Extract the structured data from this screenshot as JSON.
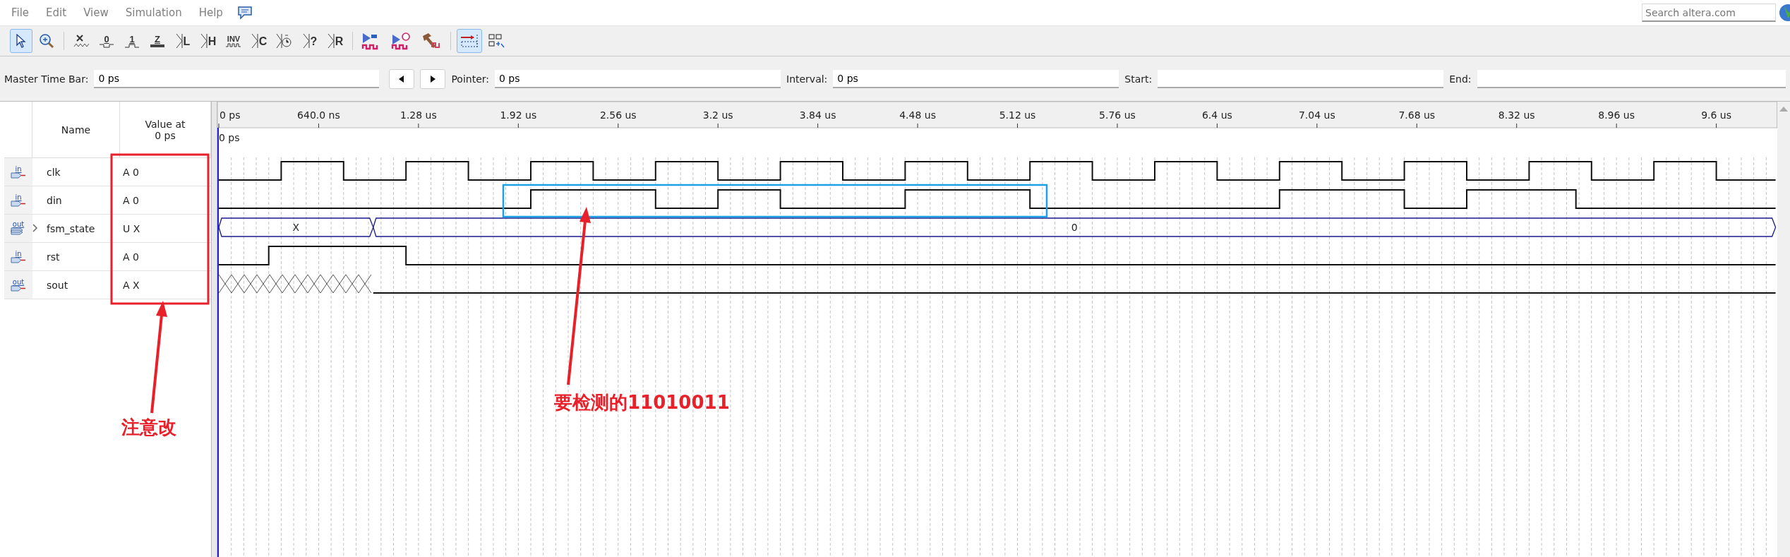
{
  "menu": [
    {
      "label": "File"
    },
    {
      "label": "Edit"
    },
    {
      "label": "View"
    },
    {
      "label": "Simulation"
    },
    {
      "label": "Help"
    }
  ],
  "search": {
    "placeholder": "Search altera.com"
  },
  "toolbar": [
    {
      "kind": "select",
      "selected": true
    },
    {
      "kind": "zoom",
      "selected": false
    },
    {
      "kind": "dontcare",
      "selected": false
    },
    {
      "kind": "low",
      "glyph": "0",
      "selected": false
    },
    {
      "kind": "high",
      "glyph": "1",
      "selected": false
    },
    {
      "kind": "hiz",
      "glyph": "Z",
      "selected": false
    },
    {
      "kind": "bracket",
      "glyph": "L",
      "selected": false
    },
    {
      "kind": "bracket",
      "glyph": "H",
      "selected": false
    },
    {
      "kind": "invert",
      "glyph": "INV",
      "selected": false
    },
    {
      "kind": "bracket",
      "glyph": "C",
      "selected": false
    },
    {
      "kind": "clock",
      "selected": false
    },
    {
      "kind": "bracket",
      "glyph": "?",
      "selected": false
    },
    {
      "kind": "bracket",
      "glyph": "R",
      "selected": false
    },
    {
      "kind": "run-functional",
      "selected": false
    },
    {
      "kind": "run-timing",
      "selected": false
    },
    {
      "kind": "netlist",
      "selected": false
    },
    {
      "kind": "snap",
      "selected": true
    },
    {
      "kind": "grid",
      "selected": false
    }
  ],
  "time_bar": {
    "master_label": "Master Time Bar:",
    "master_value": "0 ps",
    "pointer_label": "Pointer:",
    "pointer_value": "0 ps",
    "interval_label": "Interval:",
    "interval_value": "0 ps",
    "start_label": "Start:",
    "end_label": "End:"
  },
  "signal_table": {
    "columns": [
      {
        "label": "Name"
      },
      {
        "label": "Value at 0 ps"
      }
    ],
    "signals": [
      {
        "io_label": "in",
        "kind": "bit",
        "name": "clk",
        "value": "A 0"
      },
      {
        "io_label": "in",
        "kind": "bit",
        "name": "din",
        "value": "A 0"
      },
      {
        "io_label": "out",
        "kind": "bus",
        "name": "fsm_state",
        "value": "U X",
        "expanded": false
      },
      {
        "io_label": "in",
        "kind": "bit",
        "name": "rst",
        "value": "A 0"
      },
      {
        "io_label": "out",
        "kind": "bit",
        "name": "sout",
        "value": "A X"
      }
    ]
  },
  "waveform": {
    "cursor_label": "0 ps",
    "time_ruler": [
      "0 ps",
      "640.0 ns",
      "1.28 us",
      "1.92 us",
      "2.56 us",
      "3.2 us",
      "3.84 us",
      "4.48 us",
      "5.12 us",
      "5.76 us",
      "6.4 us",
      "7.04 us",
      "7.68 us",
      "8.32 us",
      "8.96 us",
      "9.6 us"
    ],
    "bus_values": [
      "X",
      "0"
    ]
  },
  "callouts": [
    {
      "text": "注意改"
    },
    {
      "text": "要检测的11010011"
    }
  ]
}
